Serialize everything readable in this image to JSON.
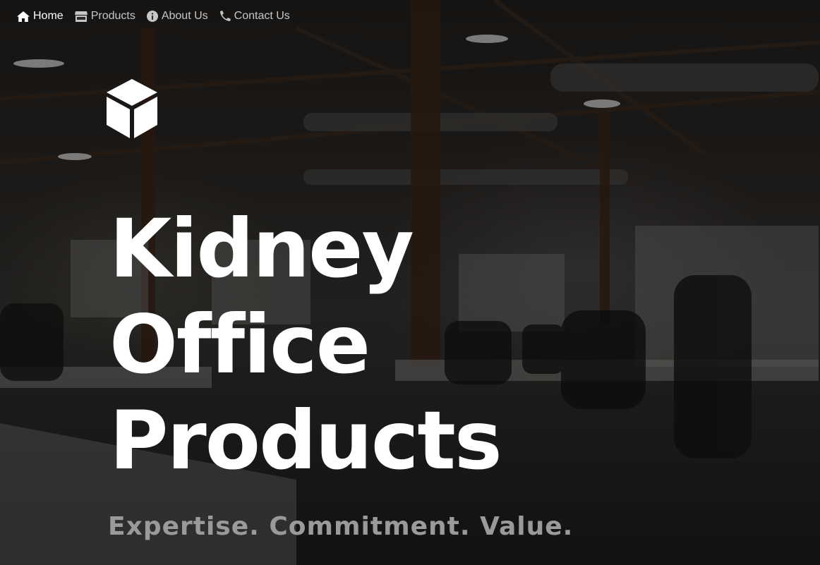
{
  "nav": {
    "items": [
      {
        "label": "Home",
        "icon": "home-icon",
        "active": true
      },
      {
        "label": "Products",
        "icon": "store-icon",
        "active": false
      },
      {
        "label": "About Us",
        "icon": "info-circle-icon",
        "active": false
      },
      {
        "label": "Contact Us",
        "icon": "phone-icon",
        "active": false
      }
    ]
  },
  "hero": {
    "logo_icon": "cube-icon",
    "title_lines": [
      "Kidney",
      "Office",
      "Products"
    ],
    "tagline": "Expertise. Commitment. Value.",
    "background": "office-interior-photo"
  },
  "colors": {
    "text_primary": "#ffffff",
    "nav_inactive": "#c6c6c6",
    "tagline": "#9a9a9a"
  }
}
